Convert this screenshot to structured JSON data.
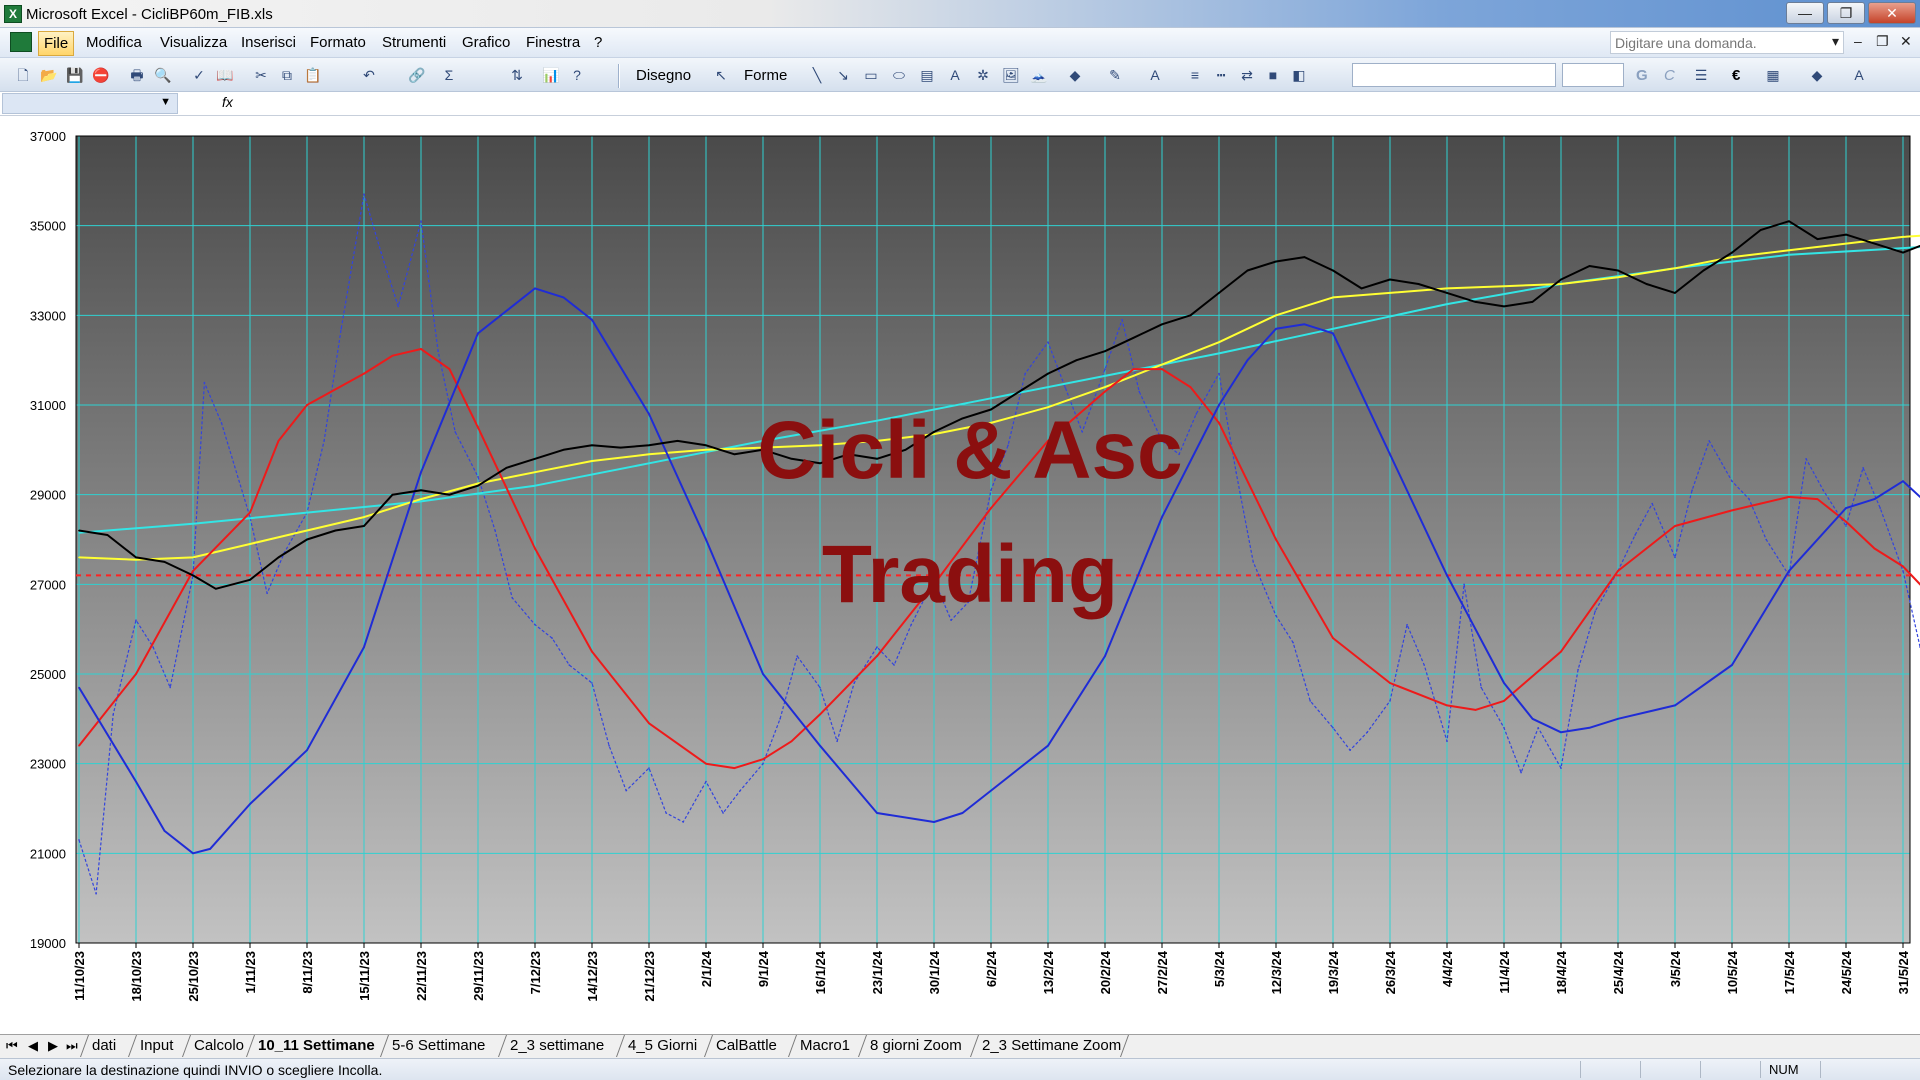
{
  "window": {
    "title": "Microsoft Excel - CicliBP60m_FIB.xls",
    "app_icon": "excel-icon",
    "controls": {
      "minimize": "—",
      "restore": "❐",
      "close": "✕"
    }
  },
  "menubar": {
    "items": [
      "File",
      "Modifica",
      "Visualizza",
      "Inserisci",
      "Formato",
      "Strumenti",
      "Grafico",
      "Finestra",
      "?"
    ],
    "active_index": 0,
    "ask_placeholder": "Digitare una domanda."
  },
  "toolbar": {
    "disegno_label": "Disegno",
    "forme_label": "Forme",
    "bold_label": "G",
    "italic_label": "C",
    "currency_label": "€"
  },
  "formulabar": {
    "fx_label": "fx"
  },
  "chart_data": {
    "type": "line",
    "watermark": [
      "Cicli & Asc",
      "Trading"
    ],
    "colors": {
      "price": "#000000",
      "yellow_ma": "#ffff33",
      "cyan_ma": "#33e5e5",
      "red_cycle": "#ee1a1a",
      "blue_cycle": "#1f2cd6",
      "dashed_oscillator": "#3344dd",
      "ref_line": "#ff2222",
      "grid": "#2fd1d1",
      "bg_top": "#4a4a4a",
      "bg_bottom": "#c2c2c2",
      "watermark": "#8b0f0f"
    },
    "y_range": [
      19000,
      37000
    ],
    "y_ticks": [
      "37000",
      "35000",
      "33000",
      "31000",
      "29000",
      "27000",
      "25000",
      "23000",
      "21000",
      "19000"
    ],
    "x_labels": [
      "11/10/23",
      "18/10/23",
      "25/10/23",
      "1/11/23",
      "8/11/23",
      "15/11/23",
      "22/11/23",
      "29/11/23",
      "7/12/23",
      "14/12/23",
      "21/12/23",
      "2/1/24",
      "9/1/24",
      "16/1/24",
      "23/1/24",
      "30/1/24",
      "6/2/24",
      "13/2/24",
      "20/2/24",
      "27/2/24",
      "5/3/24",
      "12/3/24",
      "19/3/24",
      "26/3/24",
      "4/4/24",
      "11/4/24",
      "18/4/24",
      "25/4/24",
      "3/5/24",
      "10/5/24",
      "17/5/24",
      "24/5/24",
      "31/5/24"
    ],
    "ref_line_value": 27200,
    "series": [
      {
        "key": "price",
        "style": "solid",
        "x": [
          0,
          0.5,
          1,
          1.5,
          2,
          2.4,
          3,
          3.5,
          4,
          4.5,
          5,
          5.5,
          6,
          6.5,
          7,
          7.5,
          8,
          8.5,
          9,
          9.5,
          10,
          10.5,
          11,
          11.5,
          12,
          12.5,
          13,
          13.5,
          14,
          14.5,
          15,
          15.5,
          16,
          16.5,
          17,
          17.5,
          18,
          18.5,
          19,
          19.5,
          20,
          20.5,
          21,
          21.5,
          22,
          22.5,
          23,
          23.5,
          24,
          24.5,
          25,
          25.5,
          26,
          26.5,
          27,
          27.5,
          28,
          28.5,
          29,
          29.5,
          30,
          30.5,
          31,
          31.5,
          32,
          32.6
        ],
        "values": [
          28200,
          28100,
          27600,
          27500,
          27200,
          26900,
          27100,
          27600,
          28000,
          28200,
          28300,
          29000,
          29100,
          29000,
          29200,
          29600,
          29800,
          30000,
          30100,
          30050,
          30100,
          30200,
          30100,
          29900,
          30000,
          29800,
          29700,
          29900,
          29800,
          30000,
          30400,
          30700,
          30900,
          31300,
          31700,
          32000,
          32200,
          32500,
          32800,
          33000,
          33500,
          34000,
          34200,
          34300,
          34000,
          33600,
          33800,
          33700,
          33500,
          33300,
          33200,
          33300,
          33800,
          34100,
          34000,
          33700,
          33500,
          34000,
          34400,
          34900,
          35100,
          34700,
          34800,
          34600,
          34400,
          34700
        ]
      },
      {
        "key": "yellow_ma",
        "style": "solid",
        "x": [
          0,
          1,
          2,
          3,
          4,
          5,
          6,
          7,
          8,
          9,
          10,
          11,
          12,
          13,
          14,
          15,
          16,
          17,
          18,
          19,
          20,
          21,
          22,
          23,
          24,
          25,
          26,
          27,
          28,
          29,
          30,
          31,
          32,
          32.6
        ],
        "values": [
          27600,
          27550,
          27600,
          27900,
          28200,
          28500,
          28900,
          29250,
          29500,
          29750,
          29900,
          30000,
          30050,
          30100,
          30200,
          30350,
          30600,
          30950,
          31400,
          31900,
          32400,
          33000,
          33400,
          33500,
          33600,
          33650,
          33700,
          33850,
          34050,
          34300,
          34450,
          34600,
          34750,
          34800
        ]
      },
      {
        "key": "cyan_ma",
        "style": "solid",
        "x": [
          0,
          2,
          4,
          6,
          8,
          10,
          12,
          14,
          16,
          18,
          20,
          22,
          24,
          26,
          28,
          30,
          32,
          32.6
        ],
        "values": [
          28150,
          28350,
          28600,
          28850,
          29200,
          29700,
          30200,
          30650,
          31150,
          31650,
          32150,
          32700,
          33250,
          33700,
          34050,
          34350,
          34500,
          34550
        ]
      },
      {
        "key": "red_cycle",
        "style": "solid",
        "x": [
          0,
          1,
          2,
          3,
          3.5,
          4,
          5,
          5.5,
          6,
          6.5,
          7,
          8,
          9,
          10,
          11,
          11.5,
          12,
          12.5,
          13,
          14,
          15,
          16,
          17,
          18,
          18.5,
          19,
          19.5,
          20,
          21,
          22,
          23,
          24,
          24.5,
          25,
          26,
          27,
          28,
          29,
          29.5,
          30,
          30.5,
          31,
          31.5,
          32,
          32.6
        ],
        "values": [
          23400,
          25000,
          27300,
          28600,
          30200,
          31000,
          31700,
          32100,
          32250,
          31800,
          30500,
          27800,
          25500,
          23900,
          23000,
          22900,
          23100,
          23500,
          24100,
          25400,
          27000,
          28700,
          30200,
          31300,
          31800,
          31800,
          31400,
          30600,
          28000,
          25800,
          24800,
          24300,
          24200,
          24400,
          25500,
          27300,
          28300,
          28650,
          28800,
          28950,
          28900,
          28400,
          27800,
          27400,
          26600
        ]
      },
      {
        "key": "blue_cycle",
        "style": "solid",
        "x": [
          0,
          1,
          1.5,
          2,
          2.3,
          3,
          4,
          5,
          6,
          7,
          8,
          8.5,
          9,
          10,
          11,
          12,
          13,
          14,
          15,
          15.5,
          16,
          17,
          18,
          19,
          20,
          20.5,
          21,
          21.5,
          22,
          23,
          24,
          24.5,
          25,
          25.5,
          26,
          26.5,
          27,
          28,
          29,
          30,
          31,
          31.5,
          32,
          32.6
        ],
        "values": [
          24700,
          22600,
          21500,
          21000,
          21100,
          22100,
          23300,
          25600,
          29500,
          32600,
          33600,
          33400,
          32900,
          30800,
          28000,
          25000,
          23400,
          21900,
          21700,
          21900,
          22400,
          23400,
          25400,
          28500,
          31000,
          32000,
          32700,
          32800,
          32600,
          29900,
          27200,
          26000,
          24800,
          24000,
          23700,
          23800,
          24000,
          24300,
          25200,
          27300,
          28700,
          28900,
          29300,
          28600
        ]
      },
      {
        "key": "dashed_oscillator",
        "style": "dashed",
        "x": [
          0,
          0.3,
          0.6,
          1,
          1.3,
          1.6,
          2,
          2.2,
          2.5,
          3,
          3.3,
          3.6,
          4,
          4.3,
          4.6,
          5,
          5.3,
          5.6,
          6,
          6.3,
          6.6,
          7,
          7.3,
          7.6,
          8,
          8.3,
          8.6,
          9,
          9.3,
          9.6,
          10,
          10.3,
          10.6,
          11,
          11.3,
          11.6,
          12,
          12.3,
          12.6,
          13,
          13.3,
          13.6,
          14,
          14.3,
          14.6,
          15,
          15.3,
          15.6,
          16,
          16.3,
          16.6,
          17,
          17.3,
          17.6,
          18,
          18.3,
          18.6,
          19,
          19.3,
          19.6,
          20,
          20.3,
          20.6,
          21,
          21.3,
          21.6,
          22,
          22.3,
          22.6,
          23,
          23.3,
          23.6,
          24,
          24.3,
          24.6,
          25,
          25.3,
          25.6,
          26,
          26.3,
          26.6,
          27,
          27.3,
          27.6,
          28,
          28.3,
          28.6,
          29,
          29.3,
          29.6,
          30,
          30.3,
          30.6,
          31,
          31.3,
          31.6,
          32,
          32.3,
          32.6
        ],
        "values": [
          21300,
          20100,
          24100,
          26200,
          25600,
          24700,
          27200,
          31500,
          30600,
          28500,
          26800,
          27700,
          28600,
          30200,
          32700,
          35700,
          34400,
          33200,
          35100,
          32200,
          30400,
          29400,
          28200,
          26700,
          26100,
          25800,
          25200,
          24800,
          23400,
          22400,
          22900,
          21900,
          21700,
          22600,
          21900,
          22400,
          23000,
          24000,
          25400,
          24700,
          23500,
          24800,
          25600,
          25200,
          26100,
          27100,
          26200,
          26600,
          29100,
          30100,
          31700,
          32400,
          31400,
          30400,
          31800,
          32900,
          31300,
          30200,
          29900,
          30800,
          31700,
          29500,
          27500,
          26300,
          25700,
          24400,
          23800,
          23300,
          23700,
          24400,
          26100,
          25200,
          23500,
          27000,
          24700,
          23800,
          22800,
          23800,
          22900,
          25100,
          26400,
          27300,
          28100,
          28800,
          27600,
          29100,
          30200,
          29300,
          28900,
          28000,
          27200,
          29800,
          29100,
          28300,
          29600,
          28700,
          27300,
          25600,
          24900
        ]
      }
    ]
  },
  "tabs": {
    "nav": [
      "⏮",
      "◀",
      "▶",
      "⏭"
    ],
    "items": [
      "dati",
      "Input",
      "Calcolo",
      "10_11 Settimane",
      "5-6 Settimane",
      "2_3 settimane",
      "4_5 Giorni",
      "CalBattle",
      "Macro1",
      "8 giorni Zoom",
      "2_3 Settimane Zoom"
    ],
    "active_index": 3
  },
  "statusbar": {
    "message": "Selezionare la destinazione quindi INVIO o scegliere Incolla.",
    "num": "NUM"
  }
}
